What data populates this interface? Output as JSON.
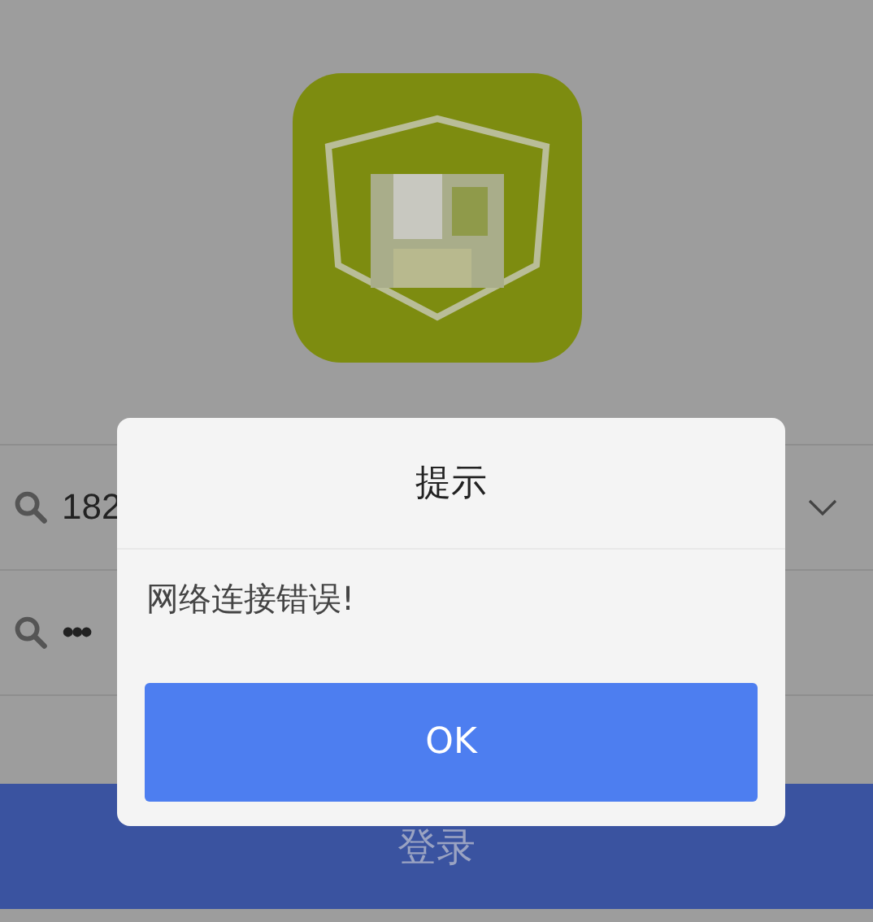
{
  "login_form": {
    "phone_field": {
      "value": "182",
      "dropdown": true
    },
    "password_field": {
      "value": "•••"
    },
    "login_button": "登录"
  },
  "dialog": {
    "title": "提示",
    "message": "网络连接错误!",
    "button": "OK"
  }
}
